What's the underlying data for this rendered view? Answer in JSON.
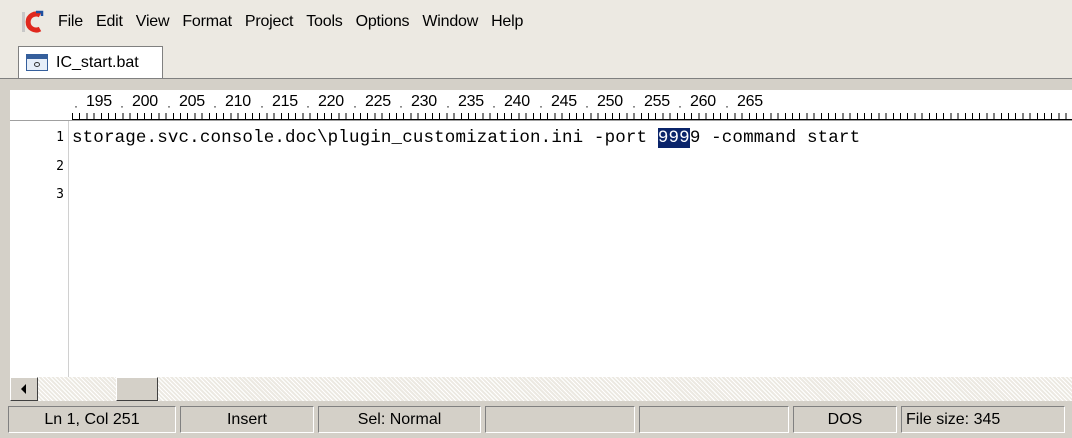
{
  "menubar": {
    "app_icon": "codelobster-logo-icon",
    "items": [
      "File",
      "Edit",
      "View",
      "Format",
      "Project",
      "Tools",
      "Options",
      "Window",
      "Help"
    ]
  },
  "tabs": [
    {
      "label": "IC_start.bat",
      "icon": "batch-file-icon"
    }
  ],
  "ruler": {
    "numbers": [
      "195",
      "200",
      "205",
      "210",
      "215",
      "220",
      "225",
      "230",
      "235",
      "240",
      "245",
      "250",
      "255",
      "260",
      "265"
    ]
  },
  "editor": {
    "line_numbers": [
      "1",
      "2",
      "3"
    ],
    "line1_before": "storage.svc.console.doc\\plugin_customization.ini -port ",
    "line1_selected": "999",
    "line1_after": "9 -command start"
  },
  "statusbar": {
    "position": "Ln 1, Col 251",
    "mode": "Insert",
    "selection": "Sel: Normal",
    "line_endings": "DOS",
    "file_size": "File size: 345"
  },
  "colors": {
    "selection": "#0a246a",
    "chrome": "#d4d0c8",
    "menubar": "#ece9e2"
  }
}
